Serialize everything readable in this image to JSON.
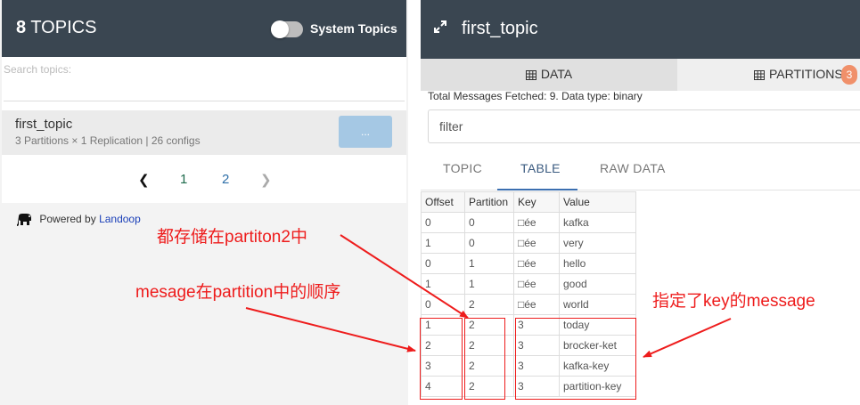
{
  "topics_panel": {
    "count": "8",
    "title": "TOPICS",
    "toggle_label": "System Topics",
    "search_placeholder": "Search topics:",
    "topic": {
      "name": "first_topic",
      "meta": "3 Partitions × 1 Replication | 26 configs",
      "button_label": "..."
    },
    "pagination": {
      "prev": "❮",
      "pages": [
        "1",
        "2"
      ],
      "next": "❯"
    },
    "powered_by": "Powered by",
    "powered_link": "Landoop"
  },
  "topic_panel": {
    "title": "first_topic",
    "tabs": {
      "data": "DATA",
      "partitions": "PARTITIONS",
      "partitions_count": "3"
    },
    "fetch_info": "Total Messages Fetched: 9. Data type: binary",
    "filter_placeholder": "filter",
    "view_tabs": [
      "TOPIC",
      "TABLE",
      "RAW DATA"
    ],
    "table": {
      "headers": [
        "Offset",
        "Partition",
        "Key",
        "Value"
      ],
      "rows": [
        [
          "0",
          "0",
          "□ée",
          "kafka"
        ],
        [
          "1",
          "0",
          "□ée",
          "very"
        ],
        [
          "0",
          "1",
          "□ée",
          "hello"
        ],
        [
          "1",
          "1",
          "□ée",
          "good"
        ],
        [
          "0",
          "2",
          "□ée",
          "world"
        ],
        [
          "1",
          "2",
          "3",
          "today"
        ],
        [
          "2",
          "2",
          "3",
          "brocker-ket"
        ],
        [
          "3",
          "2",
          "3",
          "kafka-key"
        ],
        [
          "4",
          "2",
          "3",
          "partition-key"
        ]
      ]
    }
  },
  "annotations": {
    "partition2": "都存储在partiton2中",
    "order": "mesage在partition中的顺序",
    "key": "指定了key的message",
    "color": "#ee1c1c"
  }
}
